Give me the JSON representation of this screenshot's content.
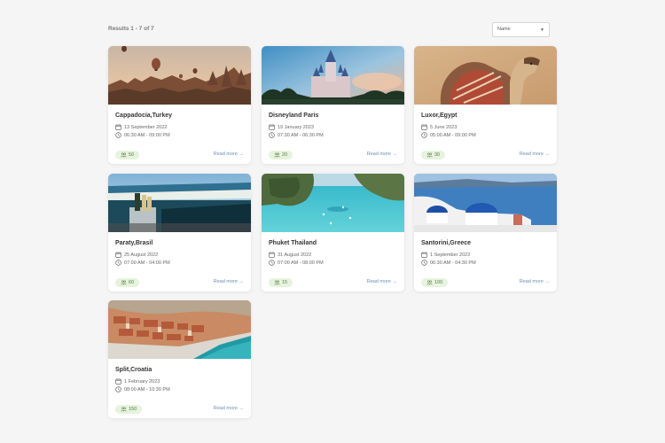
{
  "results_label": "Results 1 - 7 of 7",
  "sort_select": {
    "value": "Name"
  },
  "read_more_label": "Read more →",
  "cards": [
    {
      "title": "Cappadocia,Turkey",
      "date": "13 September 2022",
      "time": "06:30 AM - 09:00 PM",
      "capacity": "50"
    },
    {
      "title": "Disneyland Paris",
      "date": "19 January 2023",
      "time": "07:30 AM - 06:30 PM",
      "capacity": "20"
    },
    {
      "title": "Luxor,Egypt",
      "date": "5 June 2023",
      "time": "05:00 AM - 09:00 PM",
      "capacity": "30"
    },
    {
      "title": "Paraty,Brasil",
      "date": "25 August 2022",
      "time": "07:00 AM - 04:00 PM",
      "capacity": "60"
    },
    {
      "title": "Phuket Thailand",
      "date": "31 August 2022",
      "time": "07:00 AM - 08:00 PM",
      "capacity": "15"
    },
    {
      "title": "Santorini,Greece",
      "date": "1 September 2022",
      "time": "06:30 AM - 04:30 PM",
      "capacity": "100"
    },
    {
      "title": "Split,Croatia",
      "date": "1 February 2023",
      "time": "08:00 AM - 10:30 PM",
      "capacity": "150"
    }
  ]
}
